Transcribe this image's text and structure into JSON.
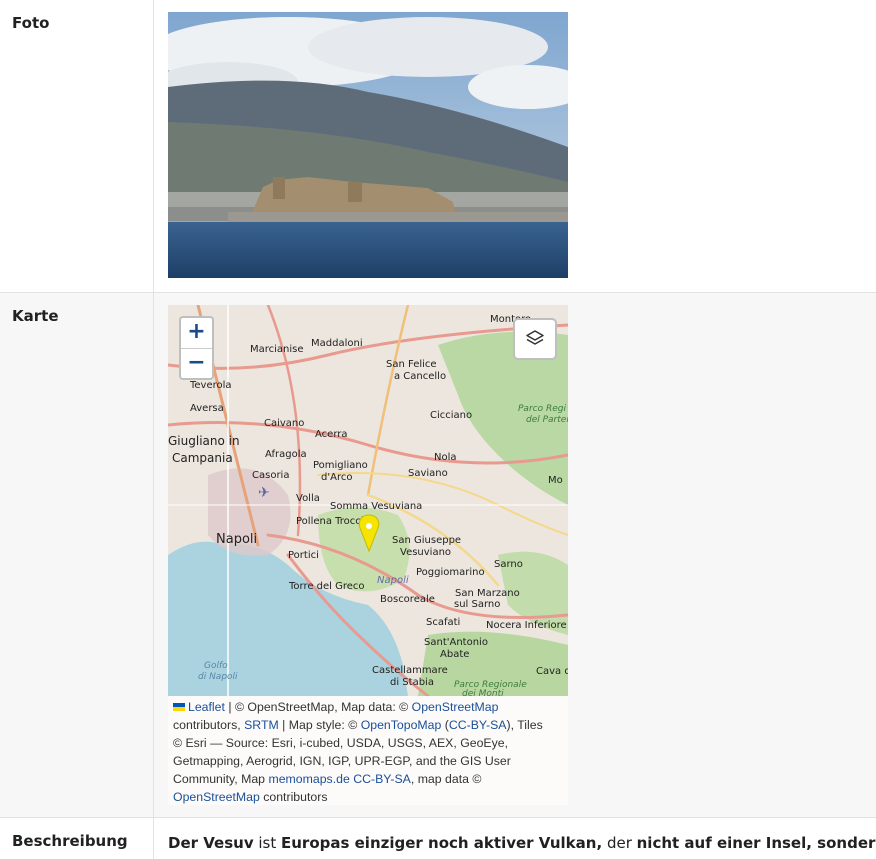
{
  "rows": {
    "foto_label": "Foto",
    "karte_label": "Karte",
    "beschreibung_label": "Beschreibung"
  },
  "map": {
    "zoom_in": "+",
    "zoom_out": "−",
    "places": [
      "Marcianise",
      "Maddaloni",
      "San Felice a Cancello",
      "Teverola",
      "Aversa",
      "Cicciano",
      "Caivano",
      "Acerra",
      "Giugliano in Campania",
      "Afragola",
      "Pomigliano d'Arco",
      "Nola",
      "Casoria",
      "Saviano",
      "Volla",
      "Somma Vesuviana",
      "Pollena Trocchia",
      "Napoli",
      "San Giuseppe Vesuviano",
      "Portici",
      "Torre del Greco",
      "Poggiomarino",
      "Sarno",
      "Boscoreale",
      "San Marzano sul Sarno",
      "Scafati",
      "Nocera Inferiore",
      "Sant'Antonio Abate",
      "Castellammare di Stabia",
      "Cava de'",
      "Golfo di Napoli",
      "Parco Regionale dei Monti",
      "Parco Regio del Parten",
      "Montoro"
    ],
    "attribution": {
      "leaflet": "Leaflet",
      "t1": " | © OpenStreetMap, Map data: © ",
      "osm1": "OpenStreetMap",
      "t2": "contributors, ",
      "srtm": "SRTM",
      "t3": " | Map style: © ",
      "opentopo": "OpenTopoMap",
      "t4": " (",
      "ccbysa1": "CC-BY-SA",
      "t5": "), Tiles",
      "t6": "© Esri — Source: Esri, i-cubed, USDA, USGS, AEX, GeoEye,",
      "t7": "Getmapping, Aerogrid, IGN, IGP, UPR-EGP, and the GIS User",
      "t8": "Community, Map ",
      "memomaps": "memomaps.de",
      "ccbysa2": "CC-BY-SA",
      "t9": ", map data ©",
      "osm2": "OpenStreetMap",
      "t10": " contributors"
    }
  },
  "description": {
    "b1": "Der Vesuv",
    "t1": " ist ",
    "b2": "Europas einziger noch aktiver Vulkan,",
    "t2": " der ",
    "b3": "nicht auf einer Insel, sondern au"
  }
}
